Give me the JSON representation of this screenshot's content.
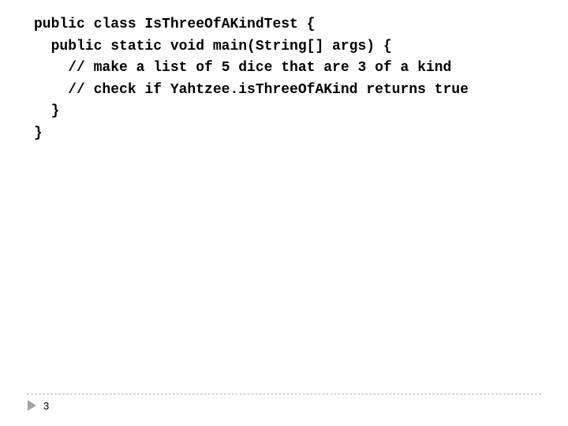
{
  "slide": {
    "code_lines": [
      "public class IsThreeOfAKindTest {",
      "  public static void main(String[] args) {",
      "    // make a list of 5 dice that are 3 of a kind",
      "    // check if Yahtzee.isThreeOfAKind returns true",
      "  }",
      "}"
    ],
    "footer": {
      "bullet_icon": "triangle-right-icon",
      "page_number": "3"
    }
  }
}
